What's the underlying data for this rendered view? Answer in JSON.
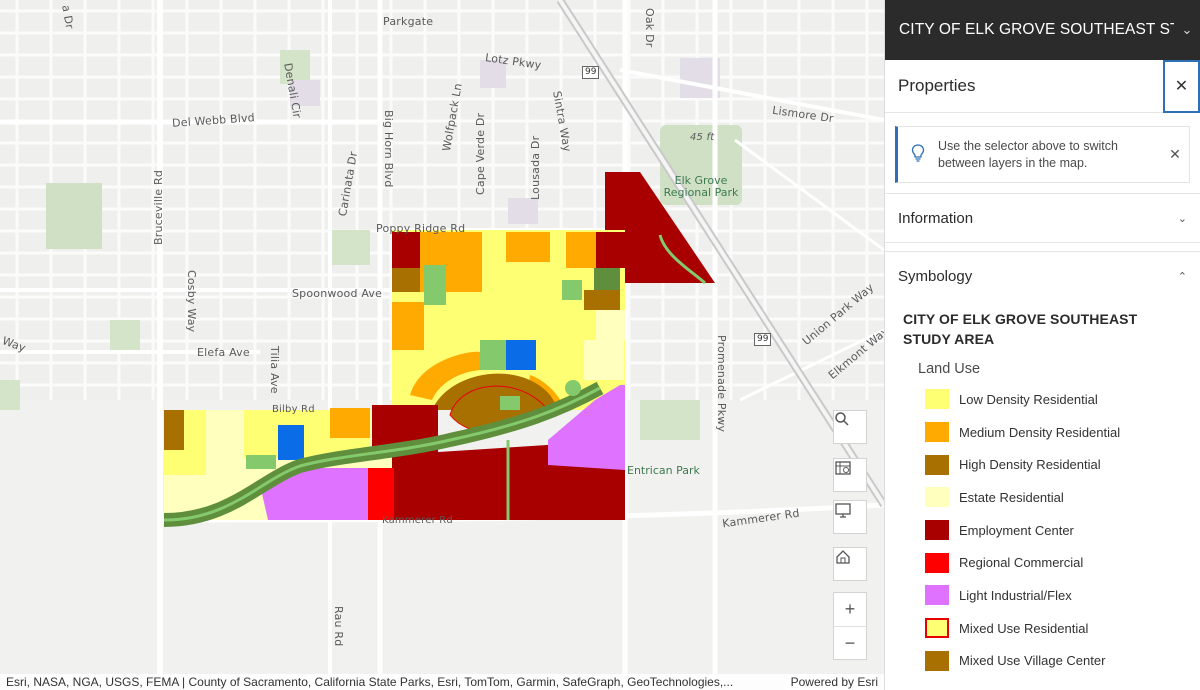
{
  "panel": {
    "title": "CITY OF ELK GROVE SOUTHEAST ST...",
    "properties_label": "Properties",
    "tip_text": "Use the selector above to switch between layers in the map.",
    "information_label": "Information",
    "symbology_label": "Symbology",
    "layer_title": "CITY OF ELK GROVE SOUTHEAST STUDY AREA",
    "field_label": "Land Use",
    "legend": [
      {
        "label": "Low Density Residential",
        "color": "#ffff73"
      },
      {
        "label": "Medium Density Residential",
        "color": "#ffaa00"
      },
      {
        "label": "High Density Residential",
        "color": "#a87000"
      },
      {
        "label": "Estate Residential",
        "color": "#ffffbe"
      },
      {
        "label": "Employment Center",
        "color": "#a80000"
      },
      {
        "label": "Regional Commercial",
        "color": "#ff0000"
      },
      {
        "label": "Light Industrial/Flex",
        "color": "#df73ff"
      },
      {
        "label": "Mixed Use Residential",
        "color": "#ffff73",
        "outline": "#e60000"
      },
      {
        "label": "Mixed Use Village Center",
        "color": "#a87000"
      }
    ]
  },
  "map": {
    "streets": {
      "parkgate": "Parkgate",
      "lotz": "Lotz Pkwy",
      "del_webb": "Del Webb Blvd",
      "denali": "Denali Cir",
      "bruceville": "Bruceville Rd",
      "cosby": "Cosby Way",
      "carinata": "Carinata Dr",
      "big_horn": "Big Horn Blvd",
      "wolfpack": "Wolfpack Ln",
      "cape_verde": "Cape Verde Dr",
      "lousada": "Lousada Dr",
      "sintra": "Sintra Way",
      "oak": "Oak Dr",
      "poppy": "Poppy Ridge Rd",
      "spoonwood": "Spoonwood Ave",
      "elefa": "Elefa Ave",
      "tilia": "Tilia Ave",
      "bilby": "Bilby Rd",
      "lismore": "Lismore Dr",
      "union_park": "Union Park Way",
      "elkmont": "Elkmont Way",
      "promenade": "Promenade Pkwy",
      "kammerer": "Kammerer Rd",
      "kammerer2": "Kammerer Rd",
      "rau": "Rau Rd",
      "way_left": "Way",
      "dr_left": "a Dr"
    },
    "shield_99": "99",
    "shield_99b": "99",
    "elevation": "45 ft",
    "park_label": "Elk Grove Regional Park",
    "entrican": "Entrican Park"
  },
  "attribution": {
    "text": "Esri, NASA, NGA, USGS, FEMA | County of Sacramento, California State Parks, Esri, TomTom, Garmin, SafeGraph, GeoTechnologies,...",
    "powered": "Powered by Esri"
  },
  "icons": {
    "search": "search-icon",
    "basemap": "basemap-gallery-icon",
    "fullscreen": "fullscreen-icon",
    "home": "home-icon",
    "zoom_in": "plus-icon",
    "zoom_out": "minus-icon"
  }
}
